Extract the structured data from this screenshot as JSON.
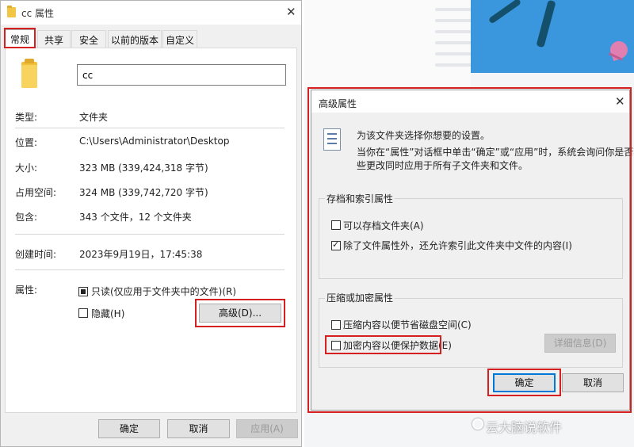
{
  "props_dialog": {
    "title": "cc 属性",
    "tabs": [
      "常规",
      "共享",
      "安全",
      "以前的版本",
      "自定义"
    ],
    "name_value": "cc",
    "rows": [
      {
        "label": "类型:",
        "value": "文件夹"
      },
      {
        "label": "位置:",
        "value": "C:\\Users\\Administrator\\Desktop"
      },
      {
        "label": "大小:",
        "value": "323 MB (339,424,318 字节)"
      },
      {
        "label": "占用空间:",
        "value": "324 MB (339,742,720 字节)"
      },
      {
        "label": "包含:",
        "value": "343 个文件，12 个文件夹"
      },
      {
        "label": "创建时间:",
        "value": "2023年9月19日，17:45:38"
      }
    ],
    "attributes_label": "属性:",
    "readonly_label": "只读(仅应用于文件夹中的文件)(R)",
    "hidden_label": "隐藏(H)",
    "advanced_button": "高级(D)...",
    "buttons": {
      "ok": "确定",
      "cancel": "取消",
      "apply": "应用(A)"
    }
  },
  "advanced_dialog": {
    "title": "高级属性",
    "intro_line1": "为该文件夹选择你想要的设置。",
    "intro_line2": "当你在“属性”对话框中单击“确定”或“应用”时，系统会询问你是否将这",
    "intro_line3": "些更改同时应用于所有子文件夹和文件。",
    "group1_title": "存档和索引属性",
    "archive_label": "可以存档文件夹(A)",
    "archive_checked": false,
    "index_label": "除了文件属性外，还允许索引此文件夹中文件的内容(I)",
    "index_checked": true,
    "group2_title": "压缩或加密属性",
    "compress_label": "压缩内容以便节省磁盘空间(C)",
    "encrypt_label": "加密内容以便保护数据(E)",
    "details_button": "详细信息(D)",
    "ok_button": "确定",
    "cancel_button": "取消"
  },
  "watermark": "云大脑说软件",
  "colors": {
    "highlight": "#d42020",
    "accent": "#0078d7",
    "illustration": "#3a97dd"
  }
}
